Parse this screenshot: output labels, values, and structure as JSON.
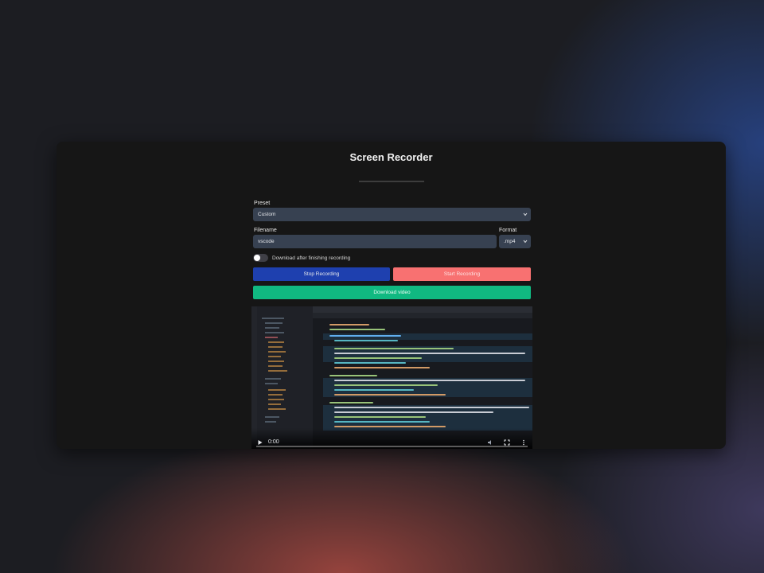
{
  "app": {
    "title": "Screen Recorder"
  },
  "form": {
    "preset_label": "Preset",
    "preset_value": "Custom",
    "filename_label": "Filename",
    "filename_value": "vscode",
    "format_label": "Format",
    "format_value": ".mp4",
    "toggle_label": "Download after finishing recording",
    "toggle_on": false
  },
  "buttons": {
    "stop": "Stop Recording",
    "start": "Start Recording",
    "download": "Download video"
  },
  "video": {
    "current_time": "0:00",
    "progress": 0,
    "icons": [
      "play-icon",
      "volume-icon",
      "fullscreen-icon",
      "more-options-icon"
    ]
  },
  "colors": {
    "stop": "#1e40af",
    "start": "#f87171",
    "download": "#10b981",
    "input_bg": "#374151"
  }
}
